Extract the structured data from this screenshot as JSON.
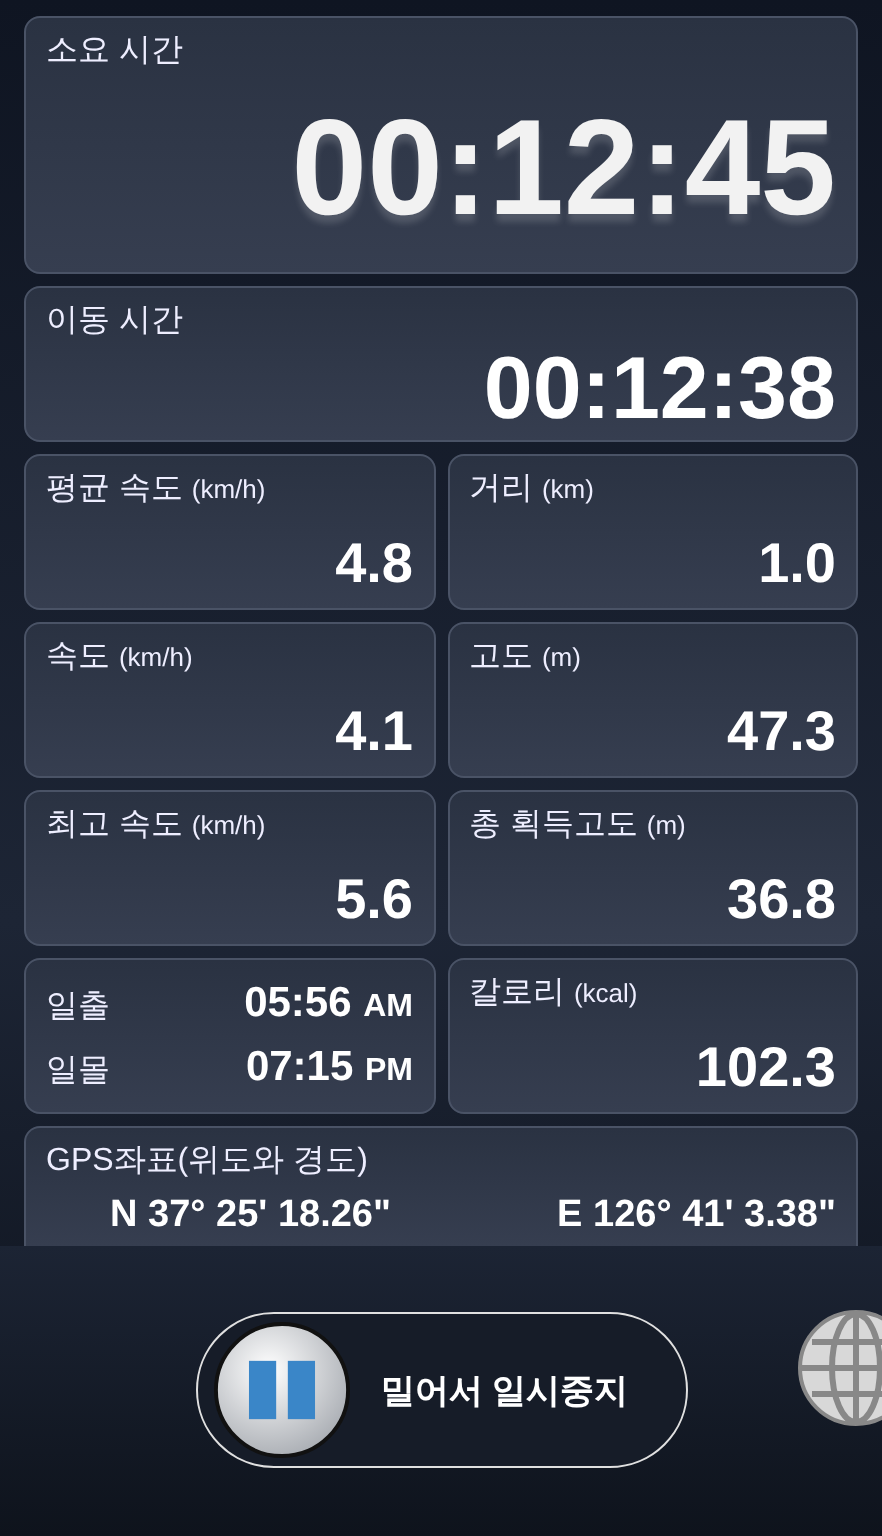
{
  "elapsed": {
    "label": "소요 시간",
    "value": "00:12:45"
  },
  "moving": {
    "label": "이동 시간",
    "value": "00:12:38"
  },
  "stats": [
    {
      "kind": "stat",
      "label": "평균 속도",
      "unit": "(km/h)",
      "value": "4.8"
    },
    {
      "kind": "stat",
      "label": "거리",
      "unit": "(km)",
      "value": "1.0"
    },
    {
      "kind": "stat",
      "label": "속도",
      "unit": "(km/h)",
      "value": "4.1"
    },
    {
      "kind": "stat",
      "label": "고도",
      "unit": "(m)",
      "value": "47.3"
    },
    {
      "kind": "stat",
      "label": "최고 속도",
      "unit": "(km/h)",
      "value": "5.6"
    },
    {
      "kind": "stat",
      "label": "총 획득고도",
      "unit": "(m)",
      "value": "36.8"
    },
    {
      "kind": "sun",
      "rows": [
        {
          "label": "일출",
          "time": "05:56",
          "suffix": "AM"
        },
        {
          "label": "일몰",
          "time": "07:15",
          "suffix": "PM"
        }
      ]
    },
    {
      "kind": "stat",
      "label": "칼로리",
      "unit": "(kcal)",
      "value": "102.3"
    }
  ],
  "gps": {
    "label": "GPS좌표(위도와 경도)",
    "latitude": "N 37° 25' 18.26\"",
    "longitude": "E 126° 41' 3.38\""
  },
  "slider": {
    "label": "밀어서 일시중지",
    "level": 0
  }
}
